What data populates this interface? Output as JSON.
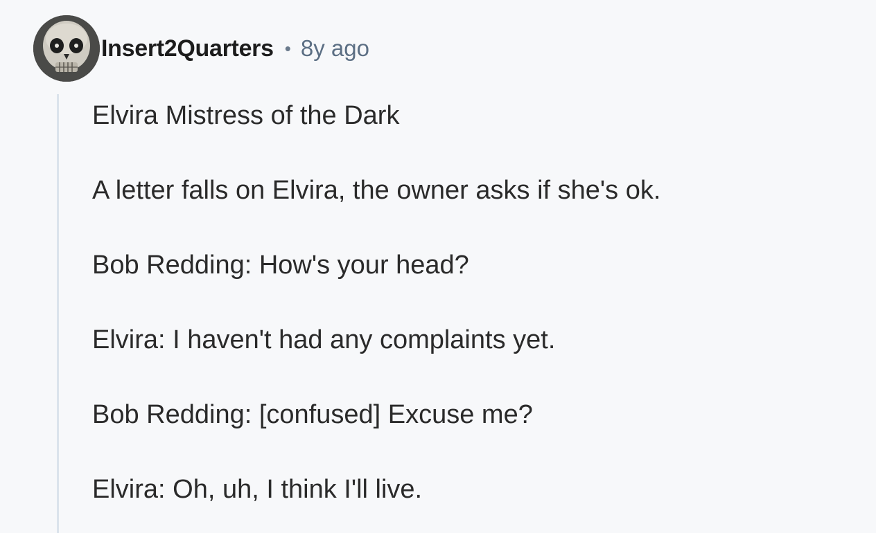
{
  "comment": {
    "author": "Insert2Quarters",
    "separator": "•",
    "age": "8y ago",
    "avatar_icon": "skull-icon",
    "paragraphs": [
      "Elvira Mistress of the Dark",
      "A letter falls on Elvira, the owner asks if she's ok.",
      "Bob Redding: How's your head?",
      "Elvira: I haven't had any complaints yet.",
      "Bob Redding: [confused] Excuse me?",
      "Elvira: Oh, uh, I think I'll live."
    ]
  },
  "colors": {
    "background": "#f7f8fa",
    "text": "#2a2a2a",
    "meta": "#5c6f84",
    "thread_line": "#dbe3ec"
  }
}
